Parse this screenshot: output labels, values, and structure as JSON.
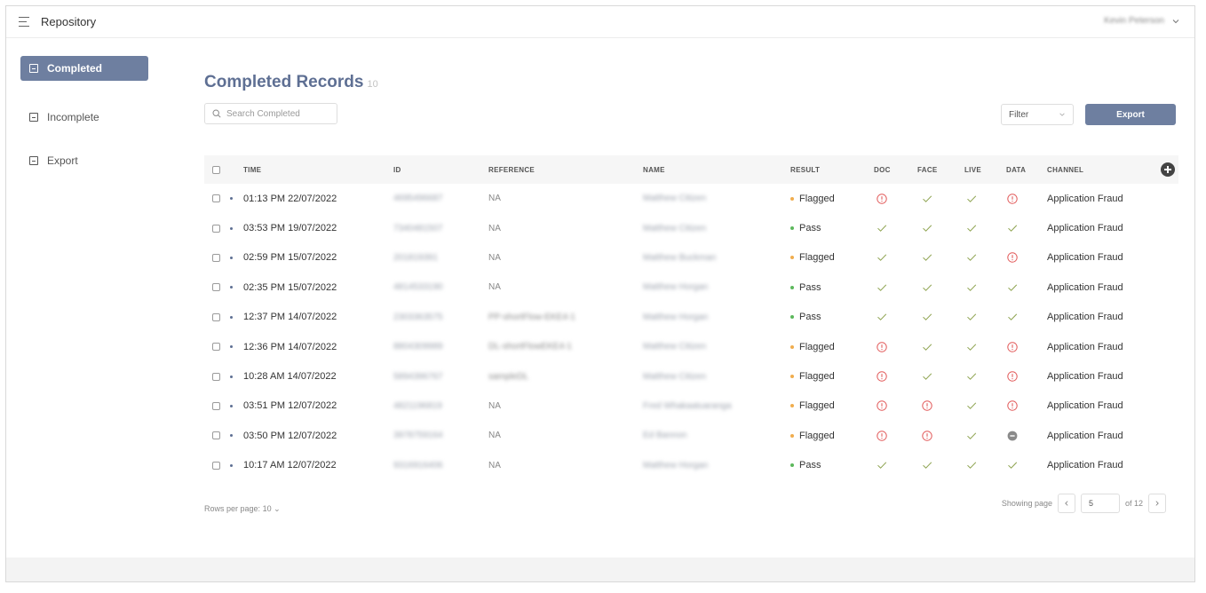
{
  "app": {
    "title": "Repository",
    "user_name": "Kevin Peterson"
  },
  "sidebar": {
    "items": [
      {
        "label": "Completed",
        "active": true
      },
      {
        "label": "Incomplete",
        "active": false
      },
      {
        "label": "Export",
        "active": false
      }
    ]
  },
  "main": {
    "title": "Completed Records",
    "count": "10",
    "search_placeholder": "Search Completed",
    "filter_label": "Filter",
    "export_label": "Export"
  },
  "table": {
    "headers": [
      "TIME",
      "ID",
      "REFERENCE",
      "NAME",
      "RESULT",
      "DOC",
      "FACE",
      "LIVE",
      "DATA",
      "CHANNEL"
    ],
    "rows": [
      {
        "time": "01:13 PM 22/07/2022",
        "id": "4695496687",
        "reference": "NA",
        "name": "Matthew Citizen",
        "result": "Flagged",
        "doc": "alert",
        "face": "check",
        "live": "check",
        "data": "alert",
        "channel": "Application Fraud"
      },
      {
        "time": "03:53 PM 19/07/2022",
        "id": "7340481507",
        "reference": "NA",
        "name": "Matthew Citizen",
        "result": "Pass",
        "doc": "check",
        "face": "check",
        "live": "check",
        "data": "check",
        "channel": "Application Fraud"
      },
      {
        "time": "02:59 PM 15/07/2022",
        "id": "201819391",
        "reference": "NA",
        "name": "Matthew Buckman",
        "result": "Flagged",
        "doc": "check",
        "face": "check",
        "live": "check",
        "data": "alert",
        "channel": "Application Fraud"
      },
      {
        "time": "02:35 PM 15/07/2022",
        "id": "4814533190",
        "reference": "NA",
        "name": "Matthew Horgan",
        "result": "Pass",
        "doc": "check",
        "face": "check",
        "live": "check",
        "data": "check",
        "channel": "Application Fraud"
      },
      {
        "time": "12:37 PM 14/07/2022",
        "id": "2303363575",
        "reference": "PP-shortFlow-EKE4-1",
        "name": "Matthew Horgan",
        "result": "Pass",
        "doc": "check",
        "face": "check",
        "live": "check",
        "data": "check",
        "channel": "Application Fraud"
      },
      {
        "time": "12:36 PM 14/07/2022",
        "id": "8804309989",
        "reference": "DL-shortFlowEKE4-1",
        "name": "Matthew Citizen",
        "result": "Flagged",
        "doc": "alert",
        "face": "check",
        "live": "check",
        "data": "alert",
        "channel": "Application Fraud"
      },
      {
        "time": "10:28 AM 14/07/2022",
        "id": "5894396767",
        "reference": "sampleDL",
        "name": "Matthew Citizen",
        "result": "Flagged",
        "doc": "alert",
        "face": "check",
        "live": "check",
        "data": "alert",
        "channel": "Application Fraud"
      },
      {
        "time": "03:51 PM 12/07/2022",
        "id": "4821196819",
        "reference": "NA",
        "name": "Fred Whakaatuaranga",
        "result": "Flagged",
        "doc": "alert",
        "face": "alert",
        "live": "check",
        "data": "alert",
        "channel": "Application Fraud"
      },
      {
        "time": "03:50 PM 12/07/2022",
        "id": "3978759164",
        "reference": "NA",
        "name": "Ed Bannon",
        "result": "Flagged",
        "doc": "alert",
        "face": "alert",
        "live": "check",
        "data": "none",
        "channel": "Application Fraud"
      },
      {
        "time": "10:17 AM 12/07/2022",
        "id": "9316916406",
        "reference": "NA",
        "name": "Matthew Horgan",
        "result": "Pass",
        "doc": "check",
        "face": "check",
        "live": "check",
        "data": "check",
        "channel": "Application Fraud"
      }
    ]
  },
  "pagination": {
    "rows_per_page_label": "Rows per page:",
    "rows_per_page_value": "10",
    "showing_label": "Showing page",
    "current_page": "5",
    "of_label": "of 12"
  },
  "colors": {
    "accent": "#6e7fa0",
    "title": "#5e6f93",
    "flagged": "#f0ad4e",
    "pass": "#5cb85c",
    "alert": "#e25c5c",
    "check": "#8aa04a",
    "none": "#8a8a8a"
  },
  "icons": {
    "alert": "alert-circle-icon",
    "check": "check-icon",
    "none": "minus-circle-icon",
    "search": "search-icon",
    "menu": "hamburger-icon"
  }
}
